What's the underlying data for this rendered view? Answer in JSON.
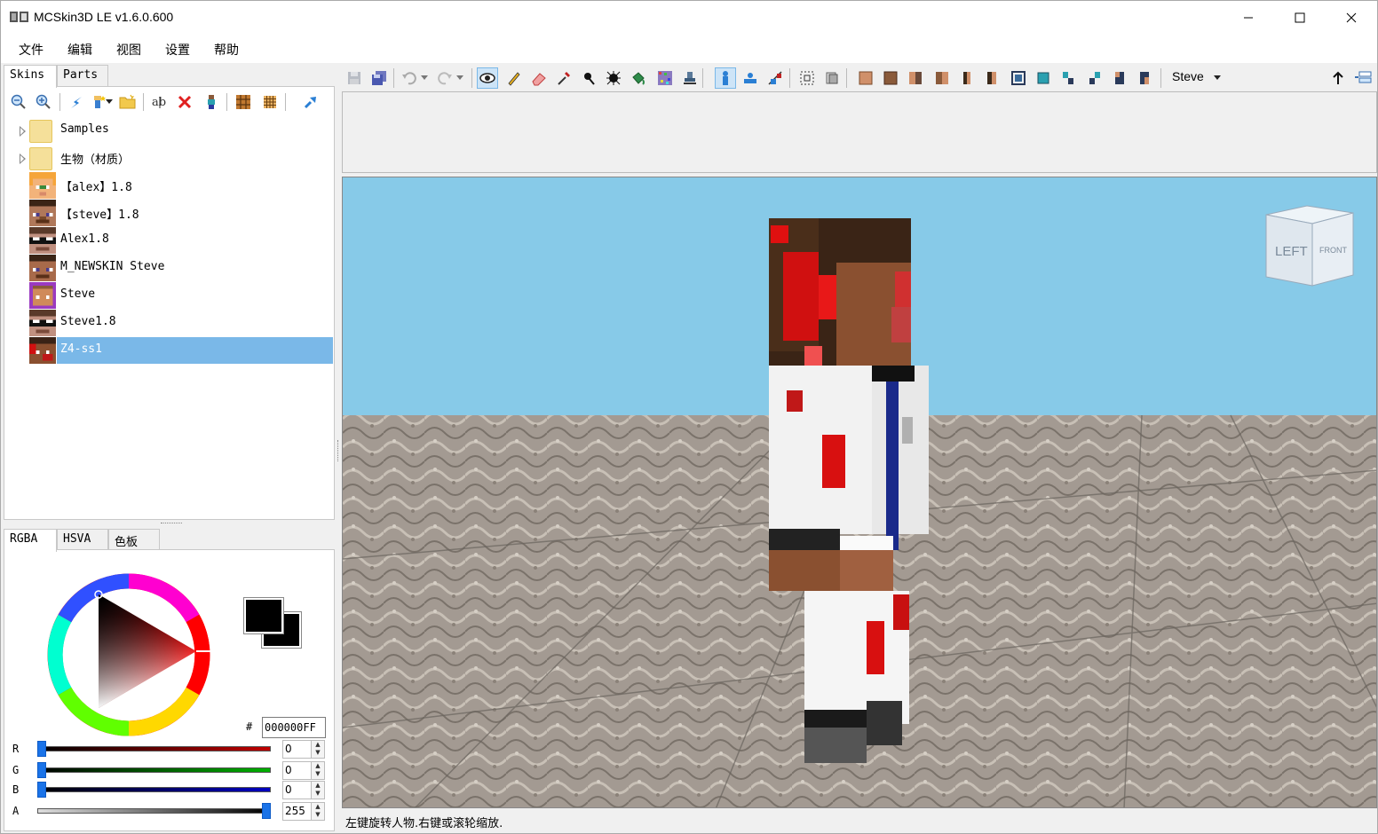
{
  "window": {
    "title": "MCSkin3D LE v1.6.0.600"
  },
  "menu": [
    "文件",
    "编辑",
    "视图",
    "设置",
    "帮助"
  ],
  "left_tabs": [
    "Skins",
    "Parts"
  ],
  "tree": [
    {
      "label": "Samples",
      "kind": "folder"
    },
    {
      "label": "生物（材质）",
      "kind": "folder"
    },
    {
      "label": "【alex】1.8",
      "kind": "skin",
      "face": "alex"
    },
    {
      "label": "【steve】1.8",
      "kind": "skin",
      "face": "steve"
    },
    {
      "label": "Alex1.8",
      "kind": "skin",
      "face": "glasses"
    },
    {
      "label": "M_NEWSKIN Steve",
      "kind": "skin",
      "face": "steve"
    },
    {
      "label": "Steve",
      "kind": "skin",
      "face": "steve-purple"
    },
    {
      "label": "Steve1.8",
      "kind": "skin",
      "face": "glasses"
    },
    {
      "label": "Z4-ss1",
      "kind": "skin",
      "face": "zombie",
      "selected": true
    }
  ],
  "color_tabs": [
    "RGBA",
    "HSVA",
    "色板"
  ],
  "color": {
    "hash": "#",
    "hex": "000000FF",
    "channels": [
      {
        "label": "R",
        "value": "0",
        "level": 0,
        "color": "#c00000"
      },
      {
        "label": "G",
        "value": "0",
        "level": 0,
        "color": "#00b000"
      },
      {
        "label": "B",
        "value": "0",
        "level": 0,
        "color": "#0000c0"
      },
      {
        "label": "A",
        "value": "255",
        "level": 1,
        "color": "#888888"
      }
    ]
  },
  "toolbar": {
    "model": "Steve"
  },
  "viewcube": {
    "left": "LEFT",
    "front": "FRONT"
  },
  "status": "左键旋转人物.右键或滚轮缩放."
}
